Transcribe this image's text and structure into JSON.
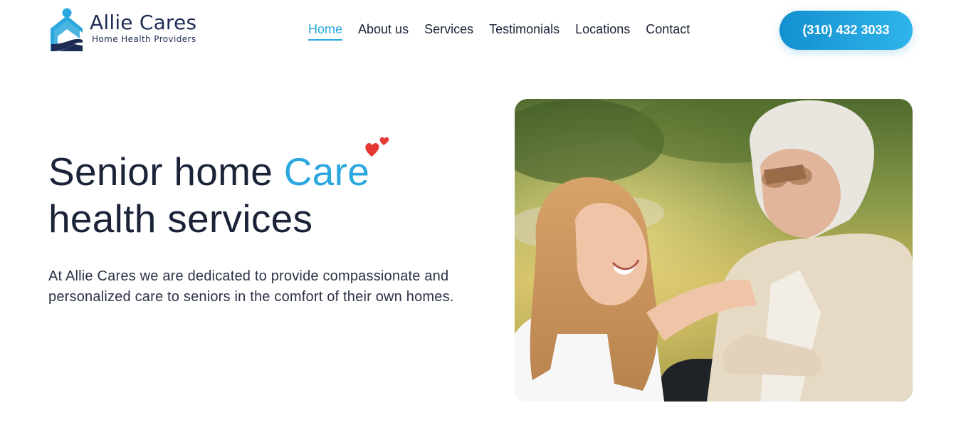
{
  "brand": {
    "name": "Allie Cares",
    "tagline": "Home Health Providers",
    "colors": {
      "primary": "#2aa7de",
      "navy": "#1e2b55",
      "text": "#1b2338",
      "heart": "#e53935"
    }
  },
  "nav": {
    "items": [
      {
        "label": "Home",
        "active": true
      },
      {
        "label": "About us",
        "active": false
      },
      {
        "label": "Services",
        "active": false
      },
      {
        "label": "Testimonials",
        "active": false
      },
      {
        "label": "Locations",
        "active": false
      },
      {
        "label": "Contact",
        "active": false
      }
    ]
  },
  "header": {
    "phone": "(310) 432 3033"
  },
  "hero": {
    "title_part1": "Senior home ",
    "title_accent": "Care",
    "title_line2": "health services",
    "description": "At Allie Cares we are dedicated to provide compassionate and personalized care to seniors in the comfort of their own homes.",
    "decoration_icon": "hearts-icon",
    "photo_icon": "caregiver-with-senior-photo"
  }
}
